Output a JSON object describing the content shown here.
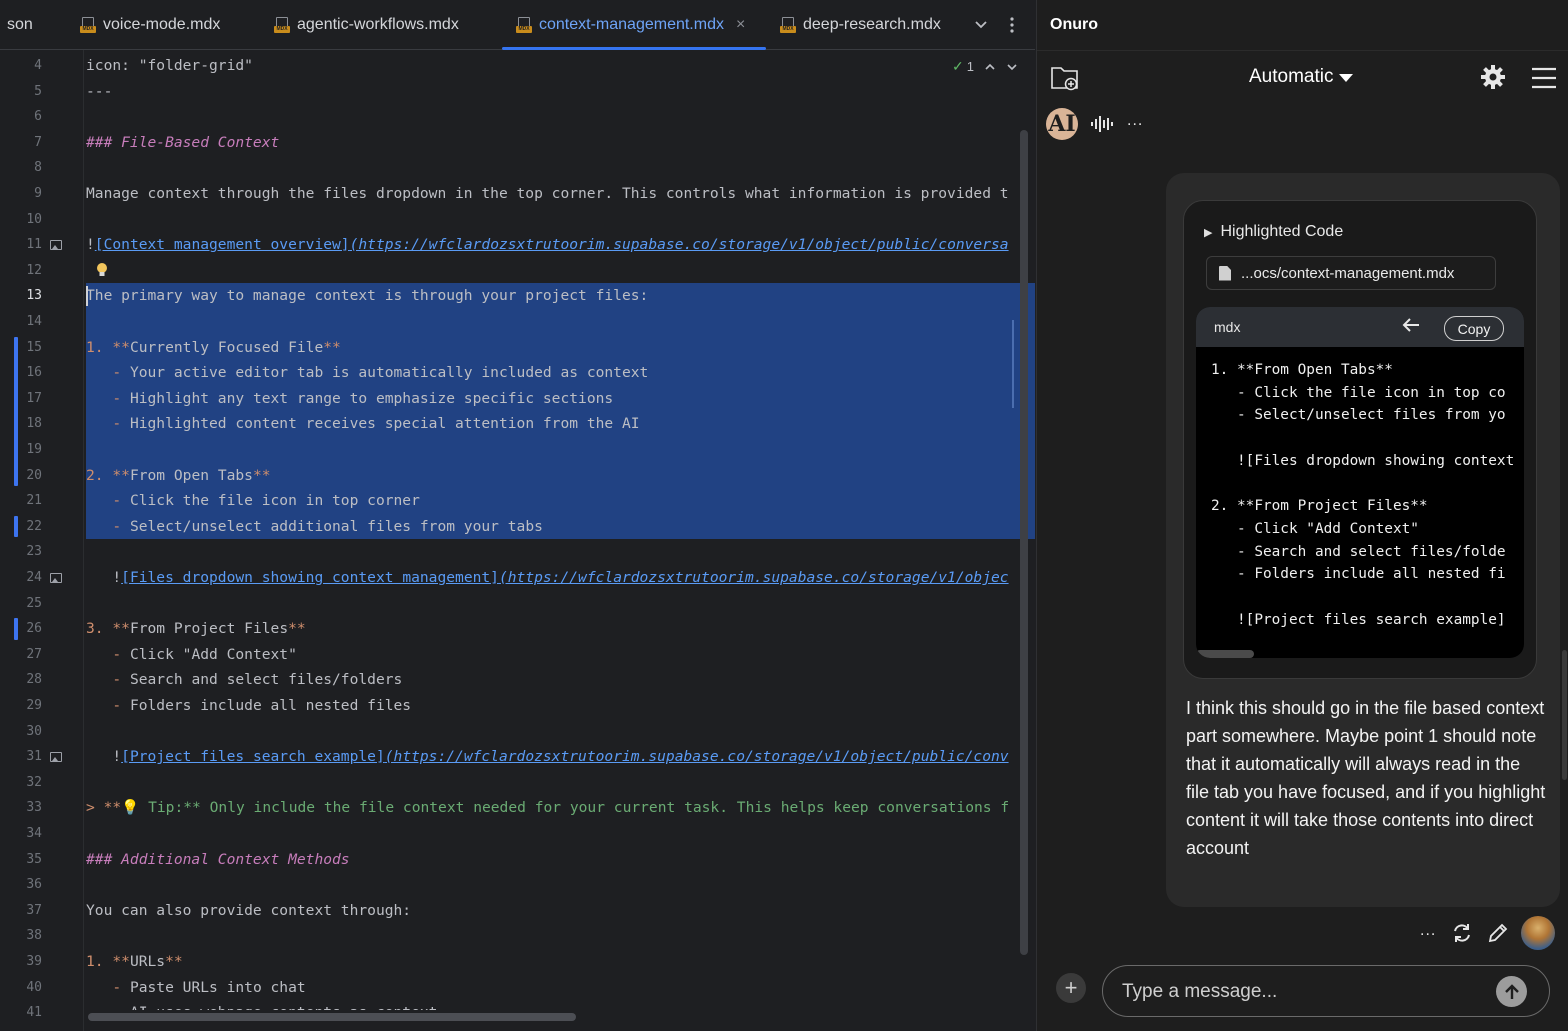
{
  "editor": {
    "tabs": [
      {
        "label": "son",
        "icon": "none",
        "active": false
      },
      {
        "label": "voice-mode.mdx",
        "icon": "mdx-file-icon",
        "active": false
      },
      {
        "label": "agentic-workflows.mdx",
        "icon": "mdx-file-icon",
        "active": false
      },
      {
        "label": "context-management.mdx",
        "icon": "mdx-file-icon",
        "active": true
      },
      {
        "label": "deep-research.mdx",
        "icon": "mdx-file-icon",
        "active": false
      }
    ],
    "tab_close_glyph": "×",
    "inspection_count": "1",
    "current_line": 13,
    "lines": [
      {
        "n": "4",
        "text": "icon: \"folder-grid\""
      },
      {
        "n": "5",
        "text": "---"
      },
      {
        "n": "6",
        "text": ""
      },
      {
        "n": "7",
        "text": "### File-Based Context"
      },
      {
        "n": "8",
        "text": ""
      },
      {
        "n": "9",
        "text": "Manage context through the files dropdown in the top corner. This controls what information is provided t"
      },
      {
        "n": "10",
        "text": ""
      },
      {
        "n": "11",
        "text_prefix": "!",
        "text_link": "[Context management overview]",
        "text_url": "(https://wfclardozsxtrutoorim.supabase.co/storage/v1/object/public/conversa"
      },
      {
        "n": "12",
        "text": ""
      },
      {
        "n": "13",
        "text": "The primary way to manage context is through your project files:"
      },
      {
        "n": "14",
        "text": ""
      },
      {
        "n": "15",
        "num": "1.",
        "bold_open": "**",
        "bold": "Currently Focused File",
        "bold_close": "**"
      },
      {
        "n": "16",
        "bullet": "   - ",
        "text": "Your active editor tab is automatically included as context"
      },
      {
        "n": "17",
        "bullet": "   - ",
        "text": "Highlight any text range to emphasize specific sections"
      },
      {
        "n": "18",
        "bullet": "   - ",
        "text": "Highlighted content receives special attention from the AI"
      },
      {
        "n": "19",
        "text": ""
      },
      {
        "n": "20",
        "num": "2.",
        "bold_open": "**",
        "bold": "From Open Tabs",
        "bold_close": "**"
      },
      {
        "n": "21",
        "bullet": "   - ",
        "text": "Click the file icon in top corner"
      },
      {
        "n": "22",
        "bullet": "   - ",
        "text": "Select/unselect additional files from your tabs"
      },
      {
        "n": "23",
        "text": ""
      },
      {
        "n": "24",
        "text_prefix": "   !",
        "text_link": "[Files dropdown showing context management]",
        "text_url": "(https://wfclardozsxtrutoorim.supabase.co/storage/v1/objec"
      },
      {
        "n": "25",
        "text": ""
      },
      {
        "n": "26",
        "num": "3.",
        "bold_open": "**",
        "bold": "From Project Files",
        "bold_close": "**"
      },
      {
        "n": "27",
        "bullet": "   - ",
        "text": "Click \"Add Context\""
      },
      {
        "n": "28",
        "bullet": "   - ",
        "text": "Search and select files/folders"
      },
      {
        "n": "29",
        "bullet": "   - ",
        "text": "Folders include all nested files"
      },
      {
        "n": "30",
        "text": ""
      },
      {
        "n": "31",
        "text_prefix": "   !",
        "text_link": "[Project files search example]",
        "text_url": "(https://wfclardozsxtrutoorim.supabase.co/storage/v1/object/public/conv"
      },
      {
        "n": "32",
        "text": ""
      },
      {
        "n": "33",
        "tip_prefix": "> **",
        "tip_icon": "💡",
        "tip_text": " Tip:** Only include the file context needed for your current task. This helps keep conversations f"
      },
      {
        "n": "34",
        "text": ""
      },
      {
        "n": "35",
        "text": "### Additional Context Methods"
      },
      {
        "n": "36",
        "text": ""
      },
      {
        "n": "37",
        "text": "You can also provide context through:"
      },
      {
        "n": "38",
        "text": ""
      },
      {
        "n": "39",
        "num": "1.",
        "bold_open": "**",
        "bold": "URLs",
        "bold_close": "**"
      },
      {
        "n": "40",
        "bullet": "   - ",
        "text": "Paste URLs into chat"
      },
      {
        "n": "41",
        "bullet": "   - ",
        "text": "AI uses webpage contents as context"
      }
    ]
  },
  "chat": {
    "title": "Onuro",
    "model": "Automatic",
    "assistant_avatar": "AI",
    "highlighted_code_label": "Highlighted Code",
    "file_chip": "...ocs/context-management.mdx",
    "code_language": "mdx",
    "copy_label": "Copy",
    "code_lines": [
      "1. **From Open Tabs**",
      "   - Click the file icon in top co",
      "   - Select/unselect files from yo",
      "",
      "   ![Files dropdown showing context",
      "",
      "2. **From Project Files**",
      "   - Click \"Add Context\"",
      "   - Search and select files/folde",
      "   - Folders include all nested fi",
      "",
      "   ![Project files search example]"
    ],
    "message_text": "I think this should go in the file based context part somewhere. Maybe point 1 should note that it automatically will always read in the file tab you have focused, and if you highlight content it will take those contents into direct account",
    "input_placeholder": "Type a message...",
    "more_glyph": "..."
  },
  "colors": {
    "accent": "#3574f0",
    "selection": "#214283",
    "heading": "#c77dbb",
    "link": "#5a9bf5",
    "markup": "#cf8e6d",
    "tip": "#6aab73"
  }
}
